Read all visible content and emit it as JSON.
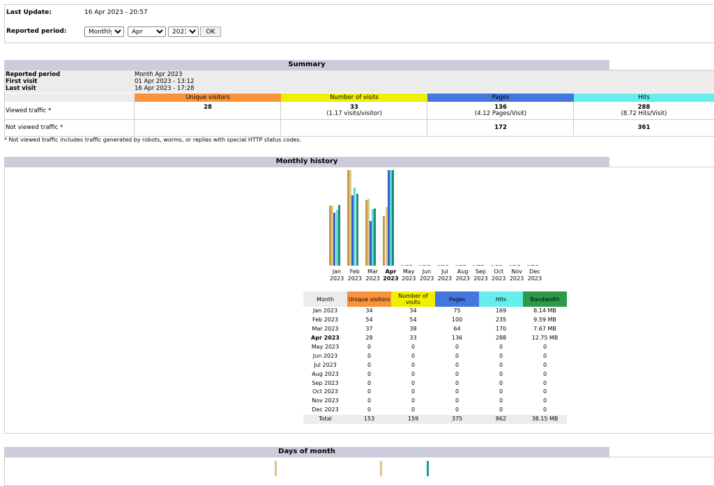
{
  "header": {
    "last_update_label": "Last Update:",
    "last_update_value": "16 Apr 2023 - 20:57",
    "period_label": "Reported period:",
    "period_type": "Monthly",
    "period_month": "Apr",
    "period_year": "2023",
    "ok_label": "OK"
  },
  "summary": {
    "title": "Summary",
    "reported_period_label": "Reported period",
    "reported_period_value": "Month Apr 2023",
    "first_visit_label": "First visit",
    "first_visit_value": "01 Apr 2023 - 13:12",
    "last_visit_label": "Last visit",
    "last_visit_value": "16 Apr 2023 - 17:28",
    "columns": [
      "Unique visitors",
      "Number of visits",
      "Pages",
      "Hits"
    ],
    "viewed_label": "Viewed traffic *",
    "viewed_unique": "28",
    "viewed_visits": "33",
    "viewed_visits_sub": "(1.17 visits/visitor)",
    "viewed_pages": "136",
    "viewed_pages_sub": "(4.12 Pages/Visit)",
    "viewed_hits": "288",
    "viewed_hits_sub": "(8.72 Hits/Visit)",
    "not_viewed_label": "Not viewed traffic *",
    "not_viewed_pages": "172",
    "not_viewed_hits": "361",
    "footnote": "* Not viewed traffic includes traffic generated by robots, worms, or replies with special HTTP status codes."
  },
  "monthly": {
    "title": "Monthly history",
    "columns": [
      "Month",
      "Unique visitors",
      "Number of visits",
      "Pages",
      "Hits",
      "Bandwidth"
    ],
    "rows": [
      {
        "month": "Jan 2023",
        "unique": "34",
        "visits": "34",
        "pages": "75",
        "hits": "169",
        "bandwidth": "8.14 MB"
      },
      {
        "month": "Feb 2023",
        "unique": "54",
        "visits": "54",
        "pages": "100",
        "hits": "235",
        "bandwidth": "9.59 MB"
      },
      {
        "month": "Mar 2023",
        "unique": "37",
        "visits": "38",
        "pages": "64",
        "hits": "170",
        "bandwidth": "7.67 MB"
      },
      {
        "month": "Apr 2023",
        "unique": "28",
        "visits": "33",
        "pages": "136",
        "hits": "288",
        "bandwidth": "12.75 MB"
      },
      {
        "month": "May 2023",
        "unique": "0",
        "visits": "0",
        "pages": "0",
        "hits": "0",
        "bandwidth": "0"
      },
      {
        "month": "Jun 2023",
        "unique": "0",
        "visits": "0",
        "pages": "0",
        "hits": "0",
        "bandwidth": "0"
      },
      {
        "month": "Jul 2023",
        "unique": "0",
        "visits": "0",
        "pages": "0",
        "hits": "0",
        "bandwidth": "0"
      },
      {
        "month": "Aug 2023",
        "unique": "0",
        "visits": "0",
        "pages": "0",
        "hits": "0",
        "bandwidth": "0"
      },
      {
        "month": "Sep 2023",
        "unique": "0",
        "visits": "0",
        "pages": "0",
        "hits": "0",
        "bandwidth": "0"
      },
      {
        "month": "Oct 2023",
        "unique": "0",
        "visits": "0",
        "pages": "0",
        "hits": "0",
        "bandwidth": "0"
      },
      {
        "month": "Nov 2023",
        "unique": "0",
        "visits": "0",
        "pages": "0",
        "hits": "0",
        "bandwidth": "0"
      },
      {
        "month": "Dec 2023",
        "unique": "0",
        "visits": "0",
        "pages": "0",
        "hits": "0",
        "bandwidth": "0"
      }
    ],
    "total": {
      "label": "Total",
      "unique": "153",
      "visits": "159",
      "pages": "375",
      "hits": "862",
      "bandwidth": "38.15 MB"
    },
    "chart_months": [
      "Jan",
      "Feb",
      "Mar",
      "Apr",
      "May",
      "Jun",
      "Jul",
      "Aug",
      "Sep",
      "Oct",
      "Nov",
      "Dec"
    ],
    "chart_year": "2023"
  },
  "days": {
    "title": "Days of month"
  },
  "colors": {
    "unique": "#f9933b",
    "visits": "#f0ef00",
    "pages": "#4477dd",
    "hits": "#66eeee",
    "bandwidth": "#2d9a4a",
    "header_bg": "#ccccdd"
  },
  "chart_data": {
    "type": "bar",
    "categories": [
      "Jan 2023",
      "Feb 2023",
      "Mar 2023",
      "Apr 2023",
      "May 2023",
      "Jun 2023",
      "Jul 2023",
      "Aug 2023",
      "Sep 2023",
      "Oct 2023",
      "Nov 2023",
      "Dec 2023"
    ],
    "series": [
      {
        "name": "Unique visitors",
        "values": [
          34,
          54,
          37,
          28,
          0,
          0,
          0,
          0,
          0,
          0,
          0,
          0
        ]
      },
      {
        "name": "Number of visits",
        "values": [
          34,
          54,
          38,
          33,
          0,
          0,
          0,
          0,
          0,
          0,
          0,
          0
        ]
      },
      {
        "name": "Pages",
        "values": [
          75,
          100,
          64,
          136,
          0,
          0,
          0,
          0,
          0,
          0,
          0,
          0
        ]
      },
      {
        "name": "Hits",
        "values": [
          169,
          235,
          170,
          288,
          0,
          0,
          0,
          0,
          0,
          0,
          0,
          0
        ]
      },
      {
        "name": "Bandwidth",
        "values": [
          8.14,
          9.59,
          7.67,
          12.75,
          0,
          0,
          0,
          0,
          0,
          0,
          0,
          0
        ]
      }
    ]
  }
}
